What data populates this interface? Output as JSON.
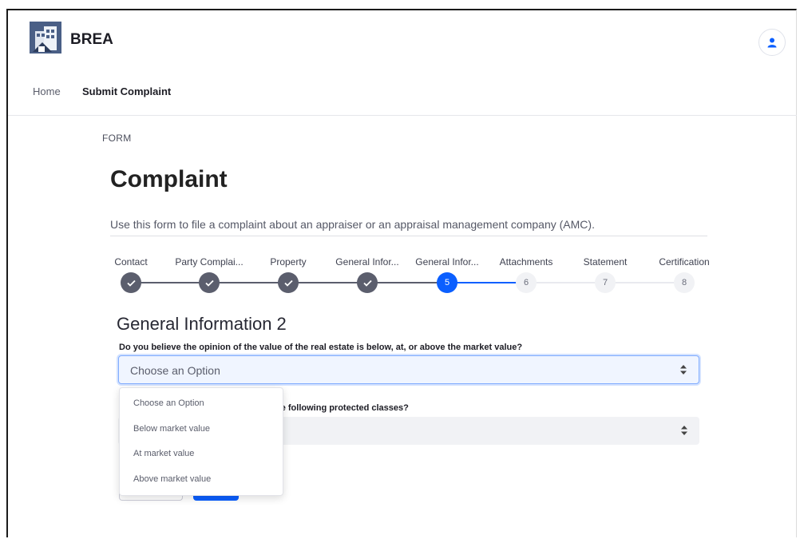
{
  "brand": {
    "name": "BREA"
  },
  "nav": {
    "home": "Home",
    "submit": "Submit Complaint"
  },
  "form": {
    "label": "FORM",
    "title": "Complaint",
    "description": "Use this form to file a complaint about an appraiser or an appraisal management company (AMC)."
  },
  "steps": [
    {
      "label": "Contact",
      "number": "1",
      "status": "done"
    },
    {
      "label": "Party Complai...",
      "number": "2",
      "status": "done"
    },
    {
      "label": "Property",
      "number": "3",
      "status": "done"
    },
    {
      "label": "General Infor...",
      "number": "4",
      "status": "done"
    },
    {
      "label": "General Infor...",
      "number": "5",
      "status": "active"
    },
    {
      "label": "Attachments",
      "number": "6",
      "status": "todo"
    },
    {
      "label": "Statement",
      "number": "7",
      "status": "todo"
    },
    {
      "label": "Certification",
      "number": "8",
      "status": "todo"
    }
  ],
  "section": {
    "title": "General Information 2",
    "question1": "Do you believe the opinion of the value of the real estate is below, at, or above the market value?",
    "select1_value": "Choose an Option",
    "question2_visible": "he following protected classes?"
  },
  "dropdown": {
    "options": [
      "Choose an Option",
      "Below market value",
      "At market value",
      "Above market value"
    ]
  },
  "colors": {
    "primary": "#0b5fff",
    "completed": "#5b5e6d",
    "pending": "#f1f2f5"
  },
  "icons": {
    "user": "user-icon",
    "check": "check-icon",
    "sort": "sort-arrows-icon"
  }
}
